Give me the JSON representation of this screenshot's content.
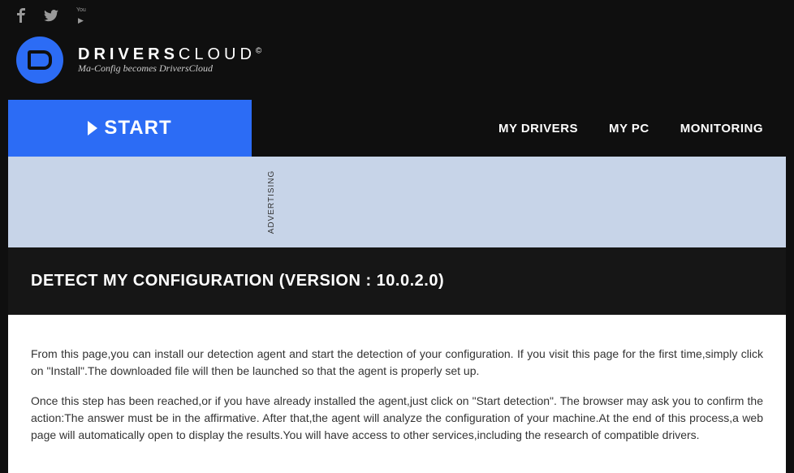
{
  "brand": {
    "line1_bold": "DRIVERS",
    "line1_light": "CLOUD",
    "copyright": "©",
    "tagline": "Ma-Config becomes DriversCloud"
  },
  "nav": {
    "start": "START",
    "items": [
      {
        "label": "MY DRIVERS"
      },
      {
        "label": "MY PC"
      },
      {
        "label": "MONITORING"
      }
    ]
  },
  "ad": {
    "label": "ADVERTISING"
  },
  "page": {
    "title": "DETECT MY CONFIGURATION (VERSION : 10.0.2.0)"
  },
  "content": {
    "p1": "From this page,you can install our detection agent and start the detection of your configuration. If you visit this page for the first time,simply click on \"Install\".The downloaded file will then be launched so that the agent is properly set up.",
    "p2": "Once this step has been reached,or if you have already installed the agent,just click on \"Start detection\". The browser may ask you to confirm the action:The answer must be in the affirmative. After that,the agent will analyze the configuration of your machine.At the end of this process,a web page will automatically open to display the results.You will have access to other services,including the research of compatible drivers."
  }
}
